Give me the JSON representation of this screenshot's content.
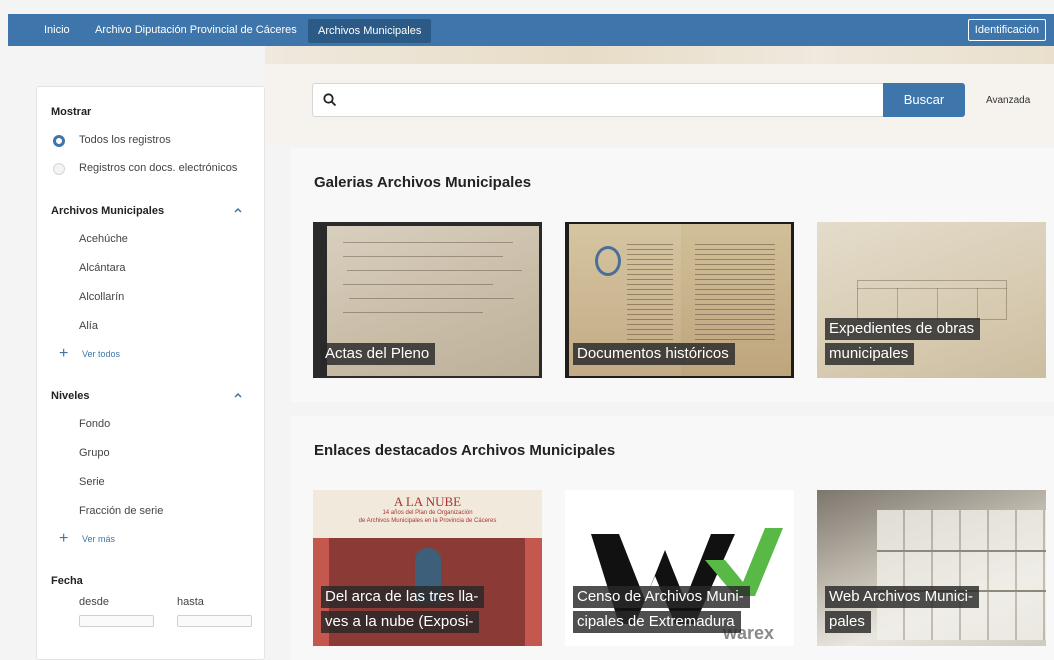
{
  "nav": {
    "items": [
      "Inicio",
      "Archivo Diputación Provincial de Cáceres"
    ],
    "active": "Archivos Municipales",
    "login": "Identificación"
  },
  "sidebar": {
    "show_title": "Mostrar",
    "show_options": [
      {
        "label": "Todos los registros",
        "selected": true
      },
      {
        "label": "Registros con docs. electrónicos",
        "selected": false
      }
    ],
    "archives_title": "Archivos Municipales",
    "archives": [
      "Acehúche",
      "Alcántara",
      "Alcollarín",
      "Alía"
    ],
    "archives_more": "Ver todos",
    "levels_title": "Niveles",
    "levels": [
      "Fondo",
      "Grupo",
      "Serie",
      "Fracción de serie"
    ],
    "levels_more": "Ver más",
    "date_title": "Fecha",
    "date_from": "desde",
    "date_to": "hasta"
  },
  "search": {
    "button": "Buscar",
    "advanced": "Avanzada"
  },
  "galleries": {
    "title": "Galerias Archivos Municipales",
    "cards": [
      {
        "lines": [
          "Actas del Pleno"
        ]
      },
      {
        "lines": [
          "Documentos históricos"
        ]
      },
      {
        "lines": [
          "Expedientes de obras",
          "municipales"
        ]
      }
    ]
  },
  "links": {
    "title": "Enlaces destacados Archivos Municipales",
    "cards": [
      {
        "lines": [
          "Del arca de las tres lla-",
          "ves a la nube (Exposi-"
        ],
        "poster_title": "A LA NUBE",
        "poster_sub1": "14 años del Plan de Organización",
        "poster_sub2": "de Archivos Municipales en la Provincia de Cáceres"
      },
      {
        "lines": [
          "Censo de Archivos Muni-",
          "cipales de Extremadura"
        ],
        "logo_text": "warex"
      },
      {
        "lines": [
          "Web Archivos Munici-",
          "pales"
        ]
      }
    ]
  },
  "colors": {
    "primary": "#3e76ab",
    "logo_green": "#58b947"
  }
}
